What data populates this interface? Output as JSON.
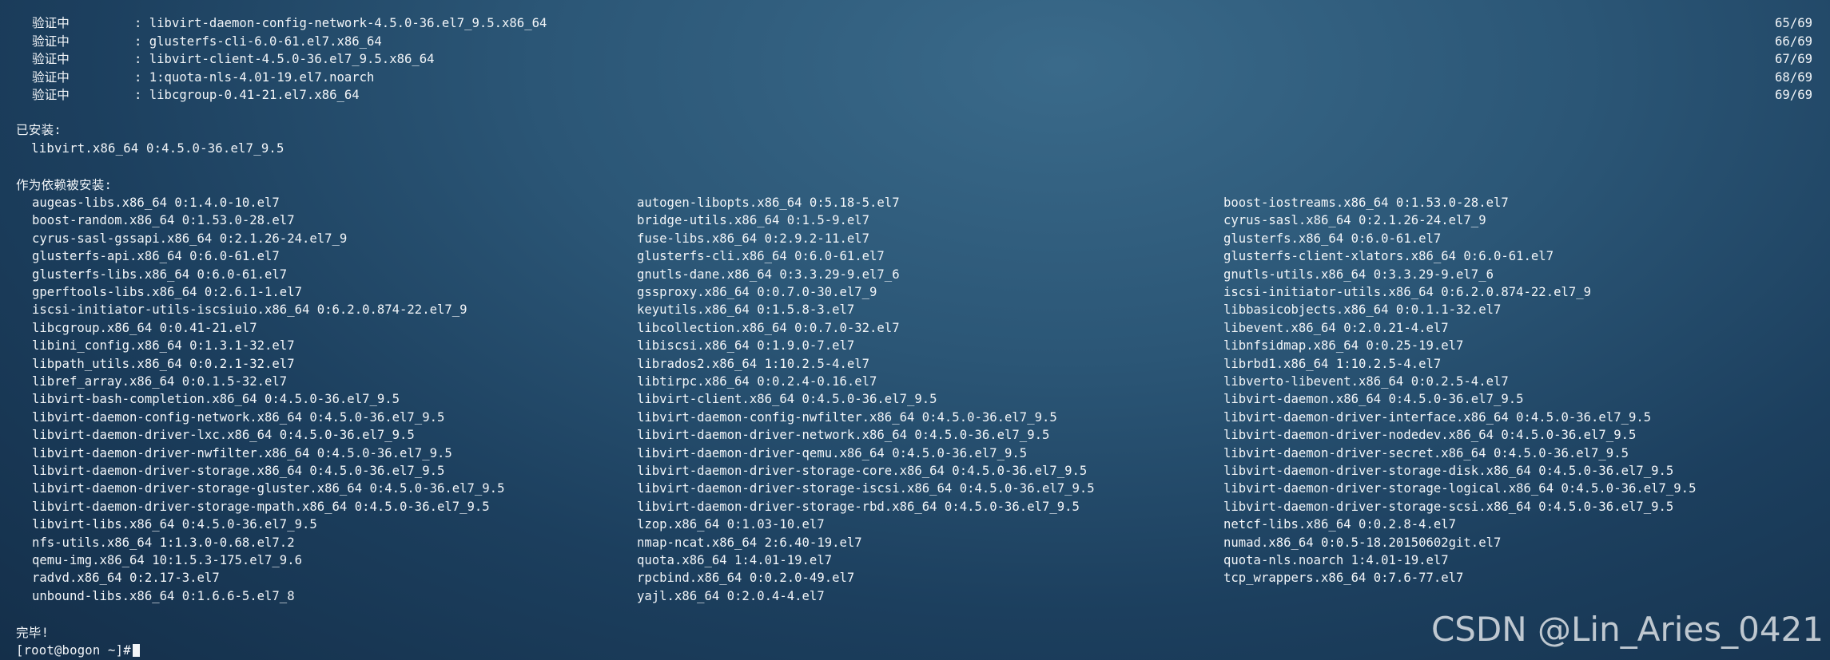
{
  "verify": [
    {
      "label": "验证中",
      "pkg": ": libvirt-daemon-config-network-4.5.0-36.el7_9.5.x86_64",
      "count": "65/69"
    },
    {
      "label": "验证中",
      "pkg": ": glusterfs-cli-6.0-61.el7.x86_64",
      "count": "66/69"
    },
    {
      "label": "验证中",
      "pkg": ": libvirt-client-4.5.0-36.el7_9.5.x86_64",
      "count": "67/69"
    },
    {
      "label": "验证中",
      "pkg": ": 1:quota-nls-4.01-19.el7.noarch",
      "count": "68/69"
    },
    {
      "label": "验证中",
      "pkg": ": libcgroup-0.41-21.el7.x86_64",
      "count": "69/69"
    }
  ],
  "installed_header": "已安装:",
  "installed_pkg": "  libvirt.x86_64 0:4.5.0-36.el7_9.5",
  "deps_header": "作为依赖被安装:",
  "deps": [
    [
      "augeas-libs.x86_64 0:1.4.0-10.el7",
      "autogen-libopts.x86_64 0:5.18-5.el7",
      "boost-iostreams.x86_64 0:1.53.0-28.el7"
    ],
    [
      "boost-random.x86_64 0:1.53.0-28.el7",
      "bridge-utils.x86_64 0:1.5-9.el7",
      "cyrus-sasl.x86_64 0:2.1.26-24.el7_9"
    ],
    [
      "cyrus-sasl-gssapi.x86_64 0:2.1.26-24.el7_9",
      "fuse-libs.x86_64 0:2.9.2-11.el7",
      "glusterfs.x86_64 0:6.0-61.el7"
    ],
    [
      "glusterfs-api.x86_64 0:6.0-61.el7",
      "glusterfs-cli.x86_64 0:6.0-61.el7",
      "glusterfs-client-xlators.x86_64 0:6.0-61.el7"
    ],
    [
      "glusterfs-libs.x86_64 0:6.0-61.el7",
      "gnutls-dane.x86_64 0:3.3.29-9.el7_6",
      "gnutls-utils.x86_64 0:3.3.29-9.el7_6"
    ],
    [
      "gperftools-libs.x86_64 0:2.6.1-1.el7",
      "gssproxy.x86_64 0:0.7.0-30.el7_9",
      "iscsi-initiator-utils.x86_64 0:6.2.0.874-22.el7_9"
    ],
    [
      "iscsi-initiator-utils-iscsiuio.x86_64 0:6.2.0.874-22.el7_9",
      "keyutils.x86_64 0:1.5.8-3.el7",
      "libbasicobjects.x86_64 0:0.1.1-32.el7"
    ],
    [
      "libcgroup.x86_64 0:0.41-21.el7",
      "libcollection.x86_64 0:0.7.0-32.el7",
      "libevent.x86_64 0:2.0.21-4.el7"
    ],
    [
      "libini_config.x86_64 0:1.3.1-32.el7",
      "libiscsi.x86_64 0:1.9.0-7.el7",
      "libnfsidmap.x86_64 0:0.25-19.el7"
    ],
    [
      "libpath_utils.x86_64 0:0.2.1-32.el7",
      "librados2.x86_64 1:10.2.5-4.el7",
      "librbd1.x86_64 1:10.2.5-4.el7"
    ],
    [
      "libref_array.x86_64 0:0.1.5-32.el7",
      "libtirpc.x86_64 0:0.2.4-0.16.el7",
      "libverto-libevent.x86_64 0:0.2.5-4.el7"
    ],
    [
      "libvirt-bash-completion.x86_64 0:4.5.0-36.el7_9.5",
      "libvirt-client.x86_64 0:4.5.0-36.el7_9.5",
      "libvirt-daemon.x86_64 0:4.5.0-36.el7_9.5"
    ],
    [
      "libvirt-daemon-config-network.x86_64 0:4.5.0-36.el7_9.5",
      "libvirt-daemon-config-nwfilter.x86_64 0:4.5.0-36.el7_9.5",
      "libvirt-daemon-driver-interface.x86_64 0:4.5.0-36.el7_9.5"
    ],
    [
      "libvirt-daemon-driver-lxc.x86_64 0:4.5.0-36.el7_9.5",
      "libvirt-daemon-driver-network.x86_64 0:4.5.0-36.el7_9.5",
      "libvirt-daemon-driver-nodedev.x86_64 0:4.5.0-36.el7_9.5"
    ],
    [
      "libvirt-daemon-driver-nwfilter.x86_64 0:4.5.0-36.el7_9.5",
      "libvirt-daemon-driver-qemu.x86_64 0:4.5.0-36.el7_9.5",
      "libvirt-daemon-driver-secret.x86_64 0:4.5.0-36.el7_9.5"
    ],
    [
      "libvirt-daemon-driver-storage.x86_64 0:4.5.0-36.el7_9.5",
      "libvirt-daemon-driver-storage-core.x86_64 0:4.5.0-36.el7_9.5",
      "libvirt-daemon-driver-storage-disk.x86_64 0:4.5.0-36.el7_9.5"
    ],
    [
      "libvirt-daemon-driver-storage-gluster.x86_64 0:4.5.0-36.el7_9.5",
      "libvirt-daemon-driver-storage-iscsi.x86_64 0:4.5.0-36.el7_9.5",
      "libvirt-daemon-driver-storage-logical.x86_64 0:4.5.0-36.el7_9.5"
    ],
    [
      "libvirt-daemon-driver-storage-mpath.x86_64 0:4.5.0-36.el7_9.5",
      "libvirt-daemon-driver-storage-rbd.x86_64 0:4.5.0-36.el7_9.5",
      "libvirt-daemon-driver-storage-scsi.x86_64 0:4.5.0-36.el7_9.5"
    ],
    [
      "libvirt-libs.x86_64 0:4.5.0-36.el7_9.5",
      "lzop.x86_64 0:1.03-10.el7",
      "netcf-libs.x86_64 0:0.2.8-4.el7"
    ],
    [
      "nfs-utils.x86_64 1:1.3.0-0.68.el7.2",
      "nmap-ncat.x86_64 2:6.40-19.el7",
      "numad.x86_64 0:0.5-18.20150602git.el7"
    ],
    [
      "qemu-img.x86_64 10:1.5.3-175.el7_9.6",
      "quota.x86_64 1:4.01-19.el7",
      "quota-nls.noarch 1:4.01-19.el7"
    ],
    [
      "radvd.x86_64 0:2.17-3.el7",
      "rpcbind.x86_64 0:0.2.0-49.el7",
      "tcp_wrappers.x86_64 0:7.6-77.el7"
    ],
    [
      "unbound-libs.x86_64 0:1.6.6-5.el7_8",
      "yajl.x86_64 0:2.0.4-4.el7",
      ""
    ]
  ],
  "complete": "完毕!",
  "prompt": "[root@bogon ~]#",
  "watermark": "CSDN @Lin_Aries_0421"
}
